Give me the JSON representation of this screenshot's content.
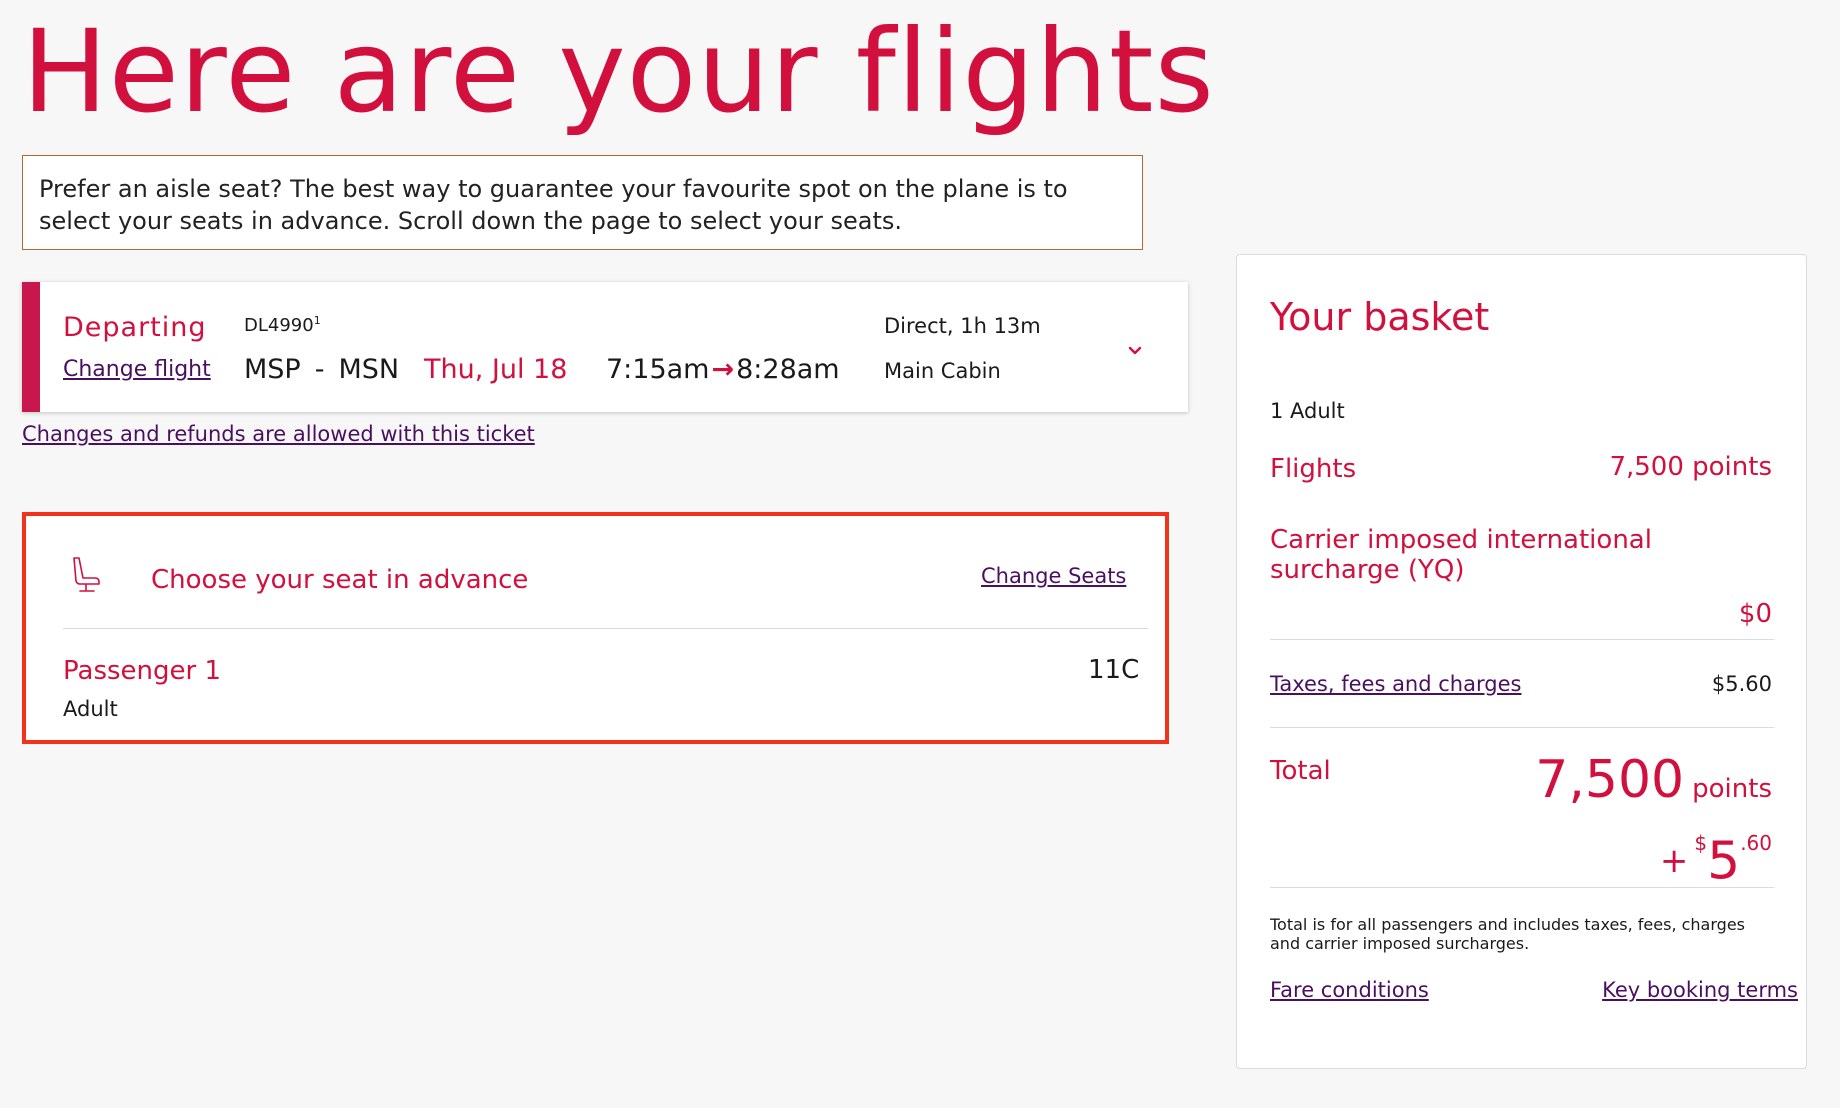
{
  "page": {
    "title": "Here are your flights"
  },
  "notice": {
    "text": "Prefer an aisle seat? The best way to guarantee your favourite spot on the plane is to select your seats in advance. Scroll down the page to select your seats."
  },
  "flight": {
    "direction": "Departing",
    "change_label": "Change flight",
    "flight_number": "DL4990",
    "flight_number_sup": "1",
    "origin": "MSP",
    "separator": "-",
    "destination": "MSN",
    "date": "Thu, Jul 18",
    "depart_time": "7:15am",
    "arrow": "→",
    "arrive_time": "8:28am",
    "stops_duration": "Direct, 1h 13m",
    "cabin": "Main Cabin",
    "expand_icon": "chevron-down-icon"
  },
  "refund_link": "Changes and refunds are allowed with this ticket",
  "seat": {
    "icon": "seat-icon",
    "heading": "Choose your seat in advance",
    "change_label": "Change Seats",
    "passenger_name": "Passenger 1",
    "passenger_type": "Adult",
    "seat_number": "11C"
  },
  "basket": {
    "title": "Your basket",
    "passengers": "1 Adult",
    "flights_label": "Flights",
    "flights_value": "7,500 points",
    "surcharge_label": "Carrier imposed international surcharge (YQ)",
    "surcharge_value": "$0",
    "taxes_label": "Taxes, fees and charges",
    "taxes_value": "$5.60",
    "total_label": "Total",
    "total_points": "7,500",
    "total_points_unit": "points",
    "total_plus": "+",
    "total_currency": "$",
    "total_cash_whole": "5",
    "total_cash_cents": ".60",
    "note": "Total is for all passengers and includes taxes, fees, charges and carrier imposed surcharges.",
    "fare_conditions": "Fare conditions",
    "key_terms": "Key booking terms"
  },
  "colors": {
    "brand_red": "#d2103e",
    "link_purple": "#4a1060",
    "highlight_border": "#f0331a"
  }
}
